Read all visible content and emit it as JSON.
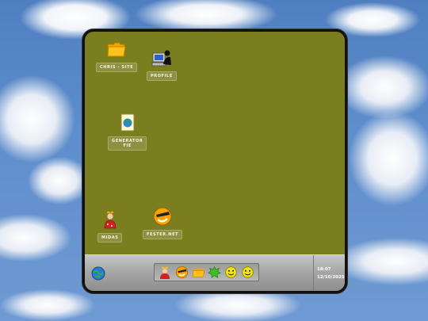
{
  "desktop": {
    "background_color": "#7b7e1f",
    "icons": [
      {
        "label": "CHRIS - SITE",
        "icon": "folder-icon"
      },
      {
        "label": "PROFILE",
        "icon": "computer-user-icon"
      },
      {
        "label": "GENERATOR \nFIE",
        "icon": "globe-document-icon"
      },
      {
        "label": "MIDAS",
        "icon": "person-icon"
      },
      {
        "label": "FESTER.NET",
        "icon": "smiley-sunglasses-icon"
      }
    ]
  },
  "taskbar": {
    "start_icon": "globe-start-icon",
    "apps": [
      "person-icon",
      "smiley-sunglasses-icon",
      "folder-icon",
      "green-splat-icon",
      "smiley-icon",
      "smiley-icon"
    ],
    "clock": {
      "time": "18:07",
      "date": "12/10/2025"
    }
  }
}
